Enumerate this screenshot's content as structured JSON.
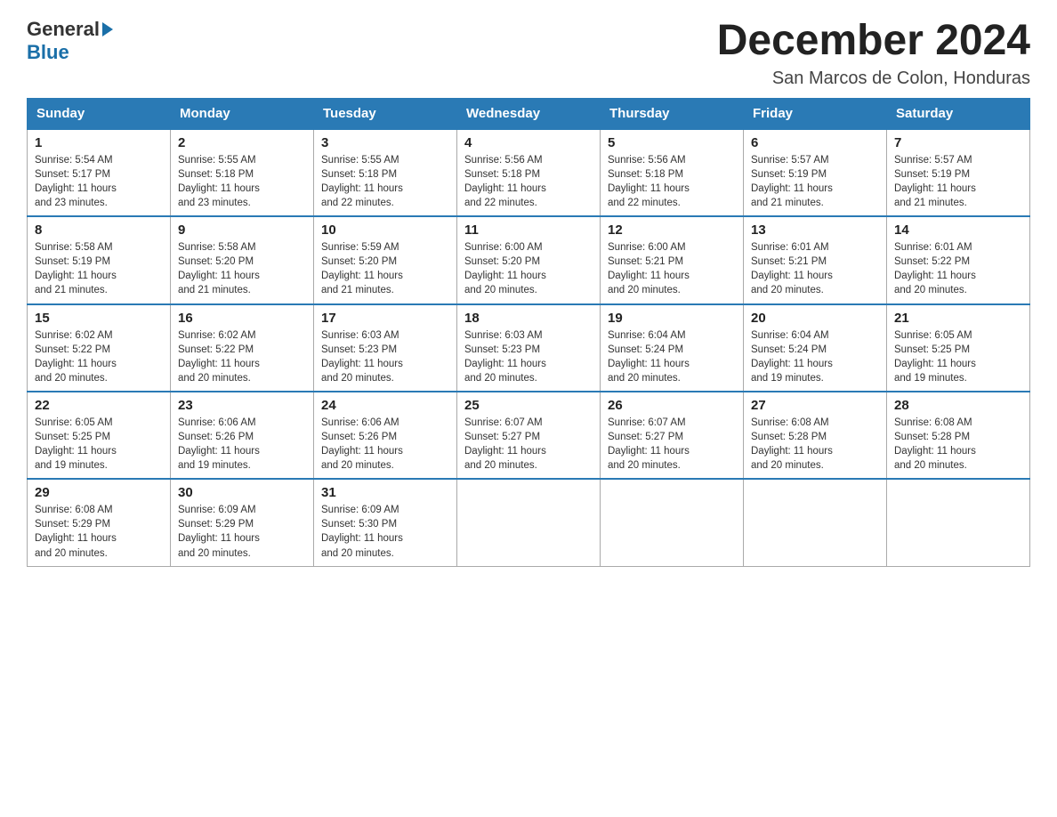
{
  "logo": {
    "general": "General",
    "blue": "Blue"
  },
  "header": {
    "month_title": "December 2024",
    "location": "San Marcos de Colon, Honduras"
  },
  "days_of_week": [
    "Sunday",
    "Monday",
    "Tuesday",
    "Wednesday",
    "Thursday",
    "Friday",
    "Saturday"
  ],
  "weeks": [
    [
      {
        "day": "1",
        "sunrise": "5:54 AM",
        "sunset": "5:17 PM",
        "daylight": "11 hours and 23 minutes."
      },
      {
        "day": "2",
        "sunrise": "5:55 AM",
        "sunset": "5:18 PM",
        "daylight": "11 hours and 23 minutes."
      },
      {
        "day": "3",
        "sunrise": "5:55 AM",
        "sunset": "5:18 PM",
        "daylight": "11 hours and 22 minutes."
      },
      {
        "day": "4",
        "sunrise": "5:56 AM",
        "sunset": "5:18 PM",
        "daylight": "11 hours and 22 minutes."
      },
      {
        "day": "5",
        "sunrise": "5:56 AM",
        "sunset": "5:18 PM",
        "daylight": "11 hours and 22 minutes."
      },
      {
        "day": "6",
        "sunrise": "5:57 AM",
        "sunset": "5:19 PM",
        "daylight": "11 hours and 21 minutes."
      },
      {
        "day": "7",
        "sunrise": "5:57 AM",
        "sunset": "5:19 PM",
        "daylight": "11 hours and 21 minutes."
      }
    ],
    [
      {
        "day": "8",
        "sunrise": "5:58 AM",
        "sunset": "5:19 PM",
        "daylight": "11 hours and 21 minutes."
      },
      {
        "day": "9",
        "sunrise": "5:58 AM",
        "sunset": "5:20 PM",
        "daylight": "11 hours and 21 minutes."
      },
      {
        "day": "10",
        "sunrise": "5:59 AM",
        "sunset": "5:20 PM",
        "daylight": "11 hours and 21 minutes."
      },
      {
        "day": "11",
        "sunrise": "6:00 AM",
        "sunset": "5:20 PM",
        "daylight": "11 hours and 20 minutes."
      },
      {
        "day": "12",
        "sunrise": "6:00 AM",
        "sunset": "5:21 PM",
        "daylight": "11 hours and 20 minutes."
      },
      {
        "day": "13",
        "sunrise": "6:01 AM",
        "sunset": "5:21 PM",
        "daylight": "11 hours and 20 minutes."
      },
      {
        "day": "14",
        "sunrise": "6:01 AM",
        "sunset": "5:22 PM",
        "daylight": "11 hours and 20 minutes."
      }
    ],
    [
      {
        "day": "15",
        "sunrise": "6:02 AM",
        "sunset": "5:22 PM",
        "daylight": "11 hours and 20 minutes."
      },
      {
        "day": "16",
        "sunrise": "6:02 AM",
        "sunset": "5:22 PM",
        "daylight": "11 hours and 20 minutes."
      },
      {
        "day": "17",
        "sunrise": "6:03 AM",
        "sunset": "5:23 PM",
        "daylight": "11 hours and 20 minutes."
      },
      {
        "day": "18",
        "sunrise": "6:03 AM",
        "sunset": "5:23 PM",
        "daylight": "11 hours and 20 minutes."
      },
      {
        "day": "19",
        "sunrise": "6:04 AM",
        "sunset": "5:24 PM",
        "daylight": "11 hours and 20 minutes."
      },
      {
        "day": "20",
        "sunrise": "6:04 AM",
        "sunset": "5:24 PM",
        "daylight": "11 hours and 19 minutes."
      },
      {
        "day": "21",
        "sunrise": "6:05 AM",
        "sunset": "5:25 PM",
        "daylight": "11 hours and 19 minutes."
      }
    ],
    [
      {
        "day": "22",
        "sunrise": "6:05 AM",
        "sunset": "5:25 PM",
        "daylight": "11 hours and 19 minutes."
      },
      {
        "day": "23",
        "sunrise": "6:06 AM",
        "sunset": "5:26 PM",
        "daylight": "11 hours and 19 minutes."
      },
      {
        "day": "24",
        "sunrise": "6:06 AM",
        "sunset": "5:26 PM",
        "daylight": "11 hours and 20 minutes."
      },
      {
        "day": "25",
        "sunrise": "6:07 AM",
        "sunset": "5:27 PM",
        "daylight": "11 hours and 20 minutes."
      },
      {
        "day": "26",
        "sunrise": "6:07 AM",
        "sunset": "5:27 PM",
        "daylight": "11 hours and 20 minutes."
      },
      {
        "day": "27",
        "sunrise": "6:08 AM",
        "sunset": "5:28 PM",
        "daylight": "11 hours and 20 minutes."
      },
      {
        "day": "28",
        "sunrise": "6:08 AM",
        "sunset": "5:28 PM",
        "daylight": "11 hours and 20 minutes."
      }
    ],
    [
      {
        "day": "29",
        "sunrise": "6:08 AM",
        "sunset": "5:29 PM",
        "daylight": "11 hours and 20 minutes."
      },
      {
        "day": "30",
        "sunrise": "6:09 AM",
        "sunset": "5:29 PM",
        "daylight": "11 hours and 20 minutes."
      },
      {
        "day": "31",
        "sunrise": "6:09 AM",
        "sunset": "5:30 PM",
        "daylight": "11 hours and 20 minutes."
      },
      null,
      null,
      null,
      null
    ]
  ]
}
